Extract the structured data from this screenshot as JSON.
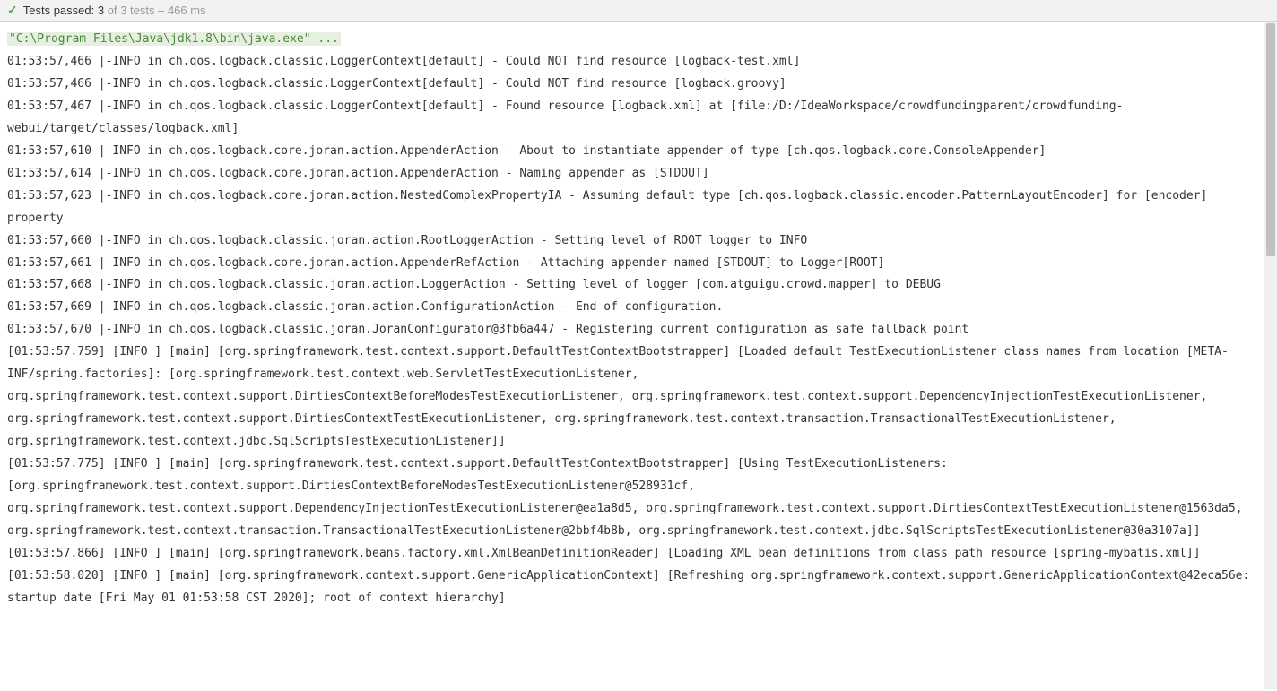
{
  "statusBar": {
    "icon": "✓",
    "label": "Tests passed:",
    "count": "3",
    "of": " of 3 tests",
    "dash": " – ",
    "time": "466 ms"
  },
  "commandLine": "\"C:\\Program Files\\Java\\jdk1.8\\bin\\java.exe\" ...",
  "logLines": [
    "01:53:57,466 |-INFO in ch.qos.logback.classic.LoggerContext[default] - Could NOT find resource [logback-test.xml]",
    "01:53:57,466 |-INFO in ch.qos.logback.classic.LoggerContext[default] - Could NOT find resource [logback.groovy]",
    "01:53:57,467 |-INFO in ch.qos.logback.classic.LoggerContext[default] - Found resource [logback.xml] at [file:/D:/IdeaWorkspace/crowdfundingparent/crowdfunding-webui/target/classes/logback.xml]",
    "01:53:57,610 |-INFO in ch.qos.logback.core.joran.action.AppenderAction - About to instantiate appender of type [ch.qos.logback.core.ConsoleAppender]",
    "01:53:57,614 |-INFO in ch.qos.logback.core.joran.action.AppenderAction - Naming appender as [STDOUT]",
    "01:53:57,623 |-INFO in ch.qos.logback.core.joran.action.NestedComplexPropertyIA - Assuming default type [ch.qos.logback.classic.encoder.PatternLayoutEncoder] for [encoder] property",
    "01:53:57,660 |-INFO in ch.qos.logback.classic.joran.action.RootLoggerAction - Setting level of ROOT logger to INFO",
    "01:53:57,661 |-INFO in ch.qos.logback.core.joran.action.AppenderRefAction - Attaching appender named [STDOUT] to Logger[ROOT]",
    "01:53:57,668 |-INFO in ch.qos.logback.classic.joran.action.LoggerAction - Setting level of logger [com.atguigu.crowd.mapper] to DEBUG",
    "01:53:57,669 |-INFO in ch.qos.logback.classic.joran.action.ConfigurationAction - End of configuration.",
    "01:53:57,670 |-INFO in ch.qos.logback.classic.joran.JoranConfigurator@3fb6a447 - Registering current configuration as safe fallback point",
    "[01:53:57.759] [INFO ] [main] [org.springframework.test.context.support.DefaultTestContextBootstrapper] [Loaded default TestExecutionListener class names from location [META-INF/spring.factories]: [org.springframework.test.context.web.ServletTestExecutionListener, org.springframework.test.context.support.DirtiesContextBeforeModesTestExecutionListener, org.springframework.test.context.support.DependencyInjectionTestExecutionListener, org.springframework.test.context.support.DirtiesContextTestExecutionListener, org.springframework.test.context.transaction.TransactionalTestExecutionListener, org.springframework.test.context.jdbc.SqlScriptsTestExecutionListener]]",
    "[01:53:57.775] [INFO ] [main] [org.springframework.test.context.support.DefaultTestContextBootstrapper] [Using TestExecutionListeners: [org.springframework.test.context.support.DirtiesContextBeforeModesTestExecutionListener@528931cf, org.springframework.test.context.support.DependencyInjectionTestExecutionListener@ea1a8d5, org.springframework.test.context.support.DirtiesContextTestExecutionListener@1563da5, org.springframework.test.context.transaction.TransactionalTestExecutionListener@2bbf4b8b, org.springframework.test.context.jdbc.SqlScriptsTestExecutionListener@30a3107a]]",
    "[01:53:57.866] [INFO ] [main] [org.springframework.beans.factory.xml.XmlBeanDefinitionReader] [Loading XML bean definitions from class path resource [spring-mybatis.xml]]",
    "[01:53:58.020] [INFO ] [main] [org.springframework.context.support.GenericApplicationContext] [Refreshing org.springframework.context.support.GenericApplicationContext@42eca56e: startup date [Fri May 01 01:53:58 CST 2020]; root of context hierarchy]"
  ]
}
